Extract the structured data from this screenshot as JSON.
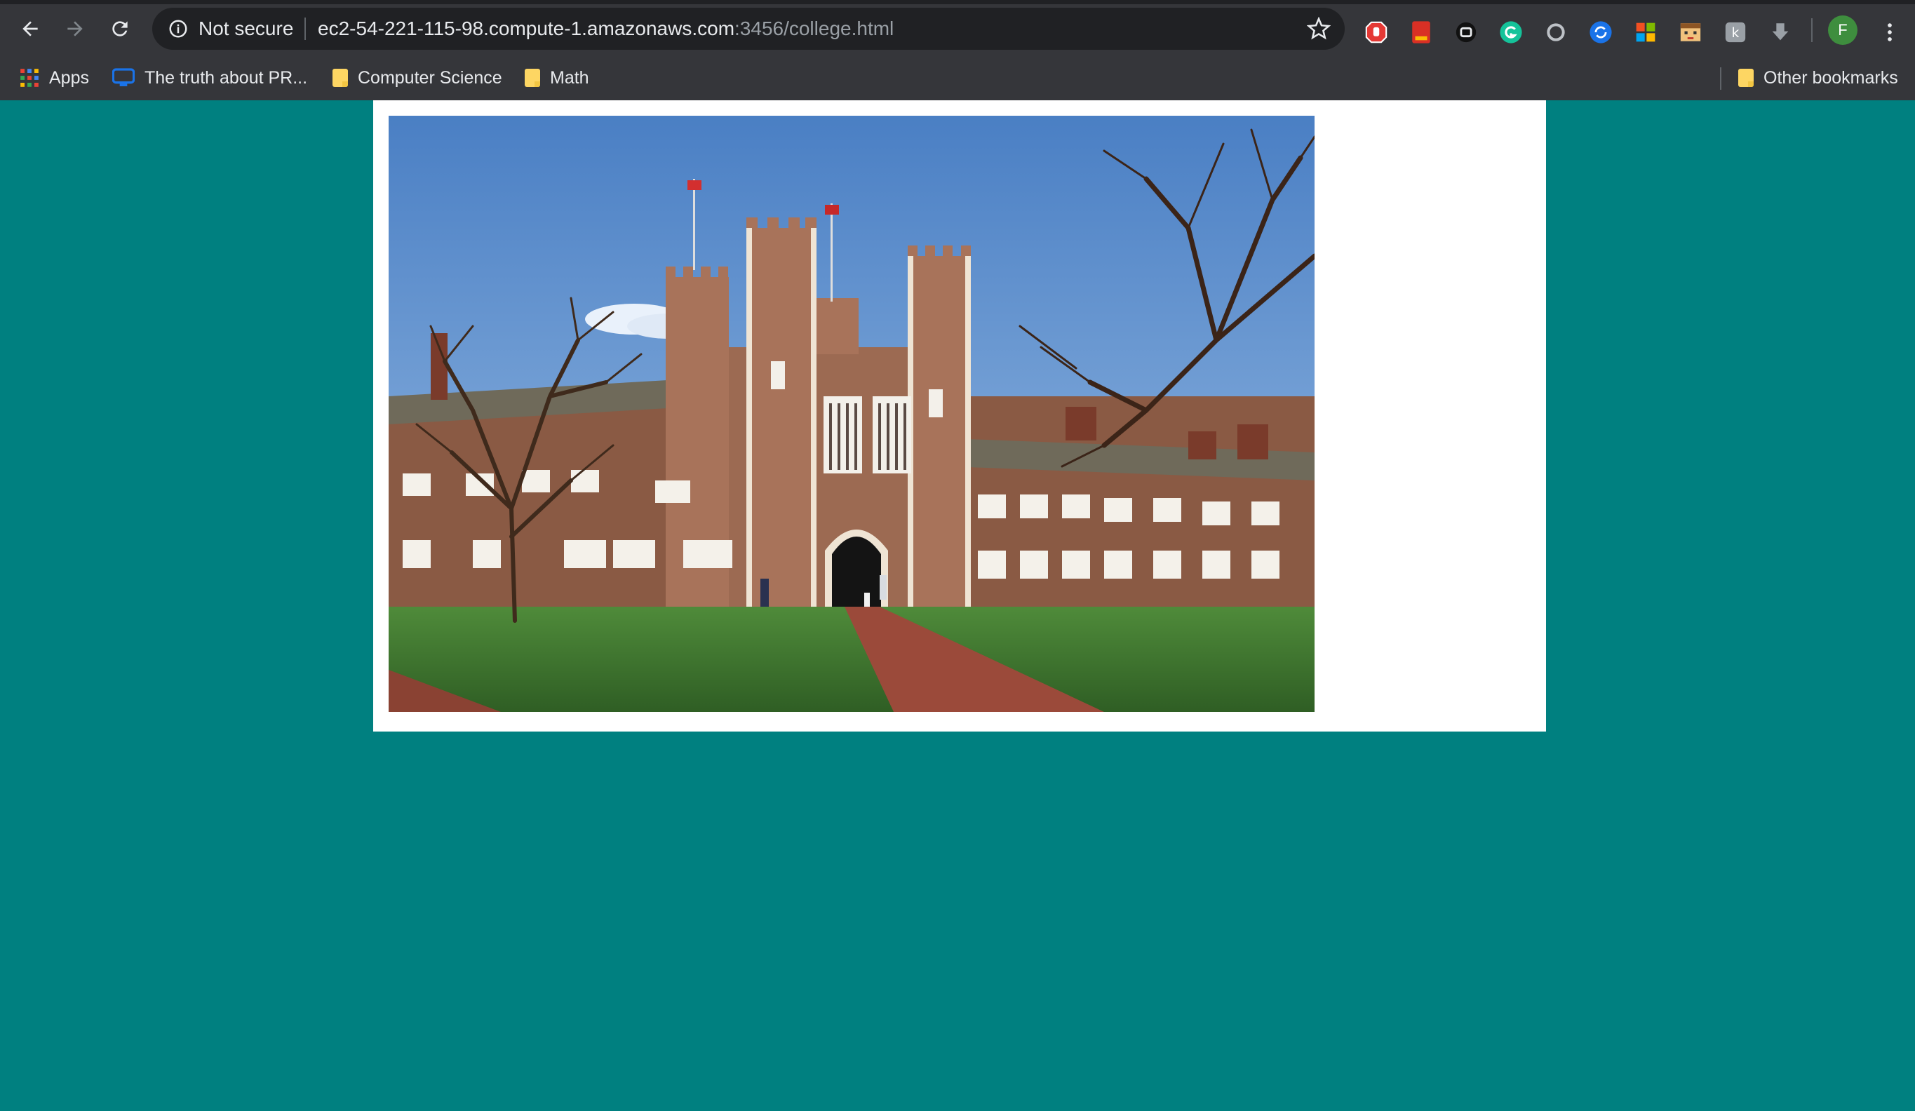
{
  "browser": {
    "security_label": "Not secure",
    "url_host": "ec2-54-221-115-98.compute-1.amazonaws.com",
    "url_path": ":3456/college.html",
    "profile_initial": "F",
    "colors": {
      "chrome_bg": "#35363a",
      "omnibox_bg": "#202124",
      "page_bg": "#008080",
      "profile": "#3e8e3e"
    },
    "toolbar_icons": [
      "back-icon",
      "forward-icon",
      "reload-icon",
      "info-icon",
      "bookmark-star-icon",
      "menu-icon"
    ],
    "extensions": [
      "adblock-icon",
      "pdf-icon",
      "extension-dark-icon",
      "grammarly-icon",
      "circle-extension-icon",
      "refresh-extension-icon",
      "microsoft-icon",
      "pixel-face-icon",
      "translate-icon",
      "download-icon"
    ]
  },
  "bookmarks": {
    "apps_label": "Apps",
    "items": [
      {
        "label": "The truth about PR...",
        "icon": "monitor-icon"
      },
      {
        "label": "Computer Science",
        "icon": "folder-icon"
      },
      {
        "label": "Math",
        "icon": "folder-icon"
      }
    ],
    "other_label": "Other bookmarks"
  },
  "page": {
    "image_alt": "college campus building"
  }
}
